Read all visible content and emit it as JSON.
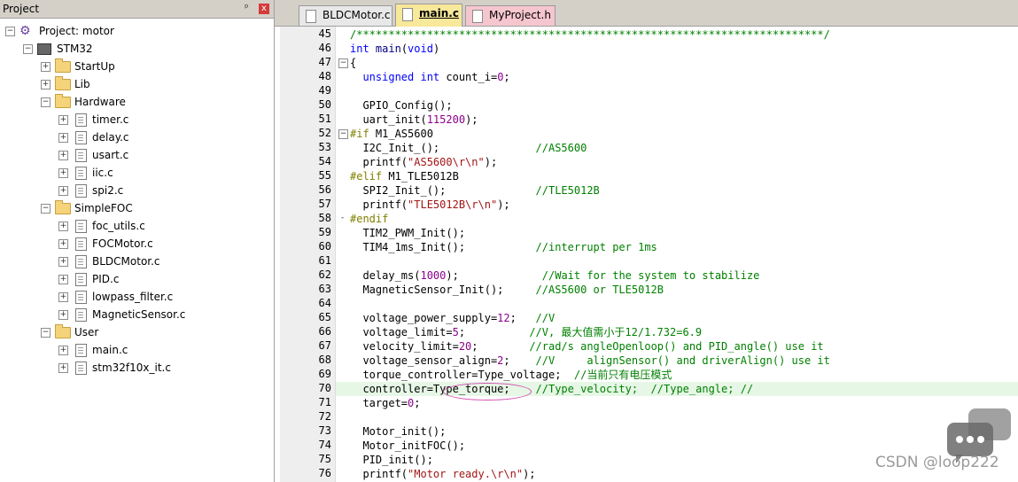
{
  "project_pane": {
    "title": "Project",
    "pin": "ᵖ",
    "close": "x",
    "tree": [
      {
        "label": "Project: motor",
        "level": 0,
        "kind": "project",
        "expander": "⊟"
      },
      {
        "label": "STM32",
        "level": 1,
        "kind": "target",
        "expander": "⊟"
      },
      {
        "label": "StartUp",
        "level": 2,
        "kind": "folder",
        "expander": "⊞"
      },
      {
        "label": "Lib",
        "level": 2,
        "kind": "folder",
        "expander": "⊞"
      },
      {
        "label": "Hardware",
        "level": 2,
        "kind": "folder",
        "expander": "⊟"
      },
      {
        "label": "timer.c",
        "level": 3,
        "kind": "file",
        "expander": "⊞"
      },
      {
        "label": "delay.c",
        "level": 3,
        "kind": "file",
        "expander": "⊞"
      },
      {
        "label": "usart.c",
        "level": 3,
        "kind": "file",
        "expander": "⊞"
      },
      {
        "label": "iic.c",
        "level": 3,
        "kind": "file",
        "expander": "⊞"
      },
      {
        "label": "spi2.c",
        "level": 3,
        "kind": "file",
        "expander": "⊞"
      },
      {
        "label": "SimpleFOC",
        "level": 2,
        "kind": "folder",
        "expander": "⊟"
      },
      {
        "label": "foc_utils.c",
        "level": 3,
        "kind": "file",
        "expander": "⊞"
      },
      {
        "label": "FOCMotor.c",
        "level": 3,
        "kind": "file",
        "expander": "⊞"
      },
      {
        "label": "BLDCMotor.c",
        "level": 3,
        "kind": "file",
        "expander": "⊞"
      },
      {
        "label": "PID.c",
        "level": 3,
        "kind": "file",
        "expander": "⊞"
      },
      {
        "label": "lowpass_filter.c",
        "level": 3,
        "kind": "file",
        "expander": "⊞"
      },
      {
        "label": "MagneticSensor.c",
        "level": 3,
        "kind": "file",
        "expander": "⊞"
      },
      {
        "label": "User",
        "level": 2,
        "kind": "folder",
        "expander": "⊟"
      },
      {
        "label": "main.c",
        "level": 3,
        "kind": "file",
        "expander": "⊞"
      },
      {
        "label": "stm32f10x_it.c",
        "level": 3,
        "kind": "file",
        "expander": "⊞"
      }
    ]
  },
  "tabs": [
    {
      "label": "BLDCMotor.c",
      "active": false,
      "color": "#e8e8e8"
    },
    {
      "label": "main.c",
      "active": true,
      "color": "#f7e89a"
    },
    {
      "label": "MyProject.h",
      "active": false,
      "color": "#f6c6ce"
    }
  ],
  "colors": {
    "keyword": "#0000ff",
    "comment": "#008000",
    "number": "#8b008b",
    "string": "#a31515",
    "preprocessor": "#808000",
    "current_line": "#e6f7e6",
    "annotation_circle": "#d24db0"
  },
  "code": {
    "highlighted_line": 70,
    "lines": [
      {
        "n": "45",
        "fold": "",
        "segs": [
          [
            "cm",
            "/*************************************************************************/"
          ]
        ]
      },
      {
        "n": "46",
        "fold": "",
        "segs": [
          [
            "kw",
            "int"
          ],
          [
            "tk",
            " main"
          ],
          [
            "",
            "("
          ],
          [
            "kw",
            "void"
          ],
          [
            "",
            ")"
          ]
        ]
      },
      {
        "n": "47",
        "fold": "⊟",
        "segs": [
          [
            "",
            "{"
          ]
        ]
      },
      {
        "n": "48",
        "fold": "",
        "segs": [
          [
            "",
            "  "
          ],
          [
            "kw",
            "unsigned int"
          ],
          [
            "",
            " count_i="
          ],
          [
            "num",
            "0"
          ],
          [
            "",
            ";"
          ]
        ]
      },
      {
        "n": "49",
        "fold": "",
        "segs": [
          [
            "",
            ""
          ]
        ]
      },
      {
        "n": "50",
        "fold": "",
        "segs": [
          [
            "",
            "  GPIO_Config();"
          ]
        ]
      },
      {
        "n": "51",
        "fold": "",
        "segs": [
          [
            "",
            "  uart_init("
          ],
          [
            "num",
            "115200"
          ],
          [
            "",
            ");"
          ]
        ]
      },
      {
        "n": "52",
        "fold": "⊟",
        "segs": [
          [
            "pp",
            "#if"
          ],
          [
            "",
            " M1_AS5600"
          ]
        ]
      },
      {
        "n": "53",
        "fold": "",
        "segs": [
          [
            "",
            "  I2C_Init_();               "
          ],
          [
            "cm",
            "//AS5600"
          ]
        ]
      },
      {
        "n": "54",
        "fold": "",
        "segs": [
          [
            "",
            "  printf("
          ],
          [
            "str",
            "\"AS5600\\r\\n\""
          ],
          [
            "",
            ");"
          ]
        ]
      },
      {
        "n": "55",
        "fold": "",
        "segs": [
          [
            "pp",
            "#elif"
          ],
          [
            "",
            " M1_TLE5012B"
          ]
        ]
      },
      {
        "n": "56",
        "fold": "",
        "segs": [
          [
            "",
            "  SPI2_Init_();              "
          ],
          [
            "cm",
            "//TLE5012B"
          ]
        ]
      },
      {
        "n": "57",
        "fold": "",
        "segs": [
          [
            "",
            "  printf("
          ],
          [
            "str",
            "\"TLE5012B\\r\\n\""
          ],
          [
            "",
            ");"
          ]
        ]
      },
      {
        "n": "58",
        "fold": "-",
        "segs": [
          [
            "pp",
            "#endif"
          ]
        ]
      },
      {
        "n": "59",
        "fold": "",
        "segs": [
          [
            "",
            "  TIM2_PWM_Init();"
          ]
        ]
      },
      {
        "n": "60",
        "fold": "",
        "segs": [
          [
            "",
            "  TIM4_1ms_Init();           "
          ],
          [
            "cm",
            "//interrupt per 1ms"
          ]
        ]
      },
      {
        "n": "61",
        "fold": "",
        "segs": [
          [
            "",
            ""
          ]
        ]
      },
      {
        "n": "62",
        "fold": "",
        "segs": [
          [
            "",
            "  delay_ms("
          ],
          [
            "num",
            "1000"
          ],
          [
            "",
            ");             "
          ],
          [
            "cm",
            "//Wait for the system to stabilize"
          ]
        ]
      },
      {
        "n": "63",
        "fold": "",
        "segs": [
          [
            "",
            "  MagneticSensor_Init();     "
          ],
          [
            "cm",
            "//AS5600 or TLE5012B"
          ]
        ]
      },
      {
        "n": "64",
        "fold": "",
        "segs": [
          [
            "",
            ""
          ]
        ]
      },
      {
        "n": "65",
        "fold": "",
        "segs": [
          [
            "",
            "  voltage_power_supply="
          ],
          [
            "num",
            "12"
          ],
          [
            "",
            ";   "
          ],
          [
            "cm",
            "//V"
          ]
        ]
      },
      {
        "n": "66",
        "fold": "",
        "segs": [
          [
            "",
            "  voltage_limit="
          ],
          [
            "num",
            "5"
          ],
          [
            "",
            ";          "
          ],
          [
            "cm",
            "//V, 最大值需小于12/1.732=6.9"
          ]
        ]
      },
      {
        "n": "67",
        "fold": "",
        "segs": [
          [
            "",
            "  velocity_limit="
          ],
          [
            "num",
            "20"
          ],
          [
            "",
            ";        "
          ],
          [
            "cm",
            "//rad/s angleOpenloop() and PID_angle() use it"
          ]
        ]
      },
      {
        "n": "68",
        "fold": "",
        "segs": [
          [
            "",
            "  voltage_sensor_align="
          ],
          [
            "num",
            "2"
          ],
          [
            "",
            ";    "
          ],
          [
            "cm",
            "//V     alignSensor() and driverAlign() use it"
          ]
        ]
      },
      {
        "n": "69",
        "fold": "",
        "segs": [
          [
            "",
            "  torque_controller=Type_voltage;  "
          ],
          [
            "cm",
            "//当前只有电压模式"
          ]
        ]
      },
      {
        "n": "70",
        "fold": "",
        "segs": [
          [
            "",
            "  controller=Type_torque;    "
          ],
          [
            "cm",
            "//Type_velocity;  //Type_angle; //"
          ]
        ]
      },
      {
        "n": "71",
        "fold": "",
        "segs": [
          [
            "",
            "  target="
          ],
          [
            "num",
            "0"
          ],
          [
            "",
            ";"
          ]
        ]
      },
      {
        "n": "72",
        "fold": "",
        "segs": [
          [
            "",
            ""
          ]
        ]
      },
      {
        "n": "73",
        "fold": "",
        "segs": [
          [
            "",
            "  Motor_init();"
          ]
        ]
      },
      {
        "n": "74",
        "fold": "",
        "segs": [
          [
            "",
            "  Motor_initFOC();"
          ]
        ]
      },
      {
        "n": "75",
        "fold": "",
        "segs": [
          [
            "",
            "  PID_init();"
          ]
        ]
      },
      {
        "n": "76",
        "fold": "",
        "segs": [
          [
            "",
            "  printf("
          ],
          [
            "str",
            "\"Motor ready.\\r\\n\""
          ],
          [
            "",
            ");"
          ]
        ]
      }
    ]
  },
  "watermark": "CSDN @loop222"
}
